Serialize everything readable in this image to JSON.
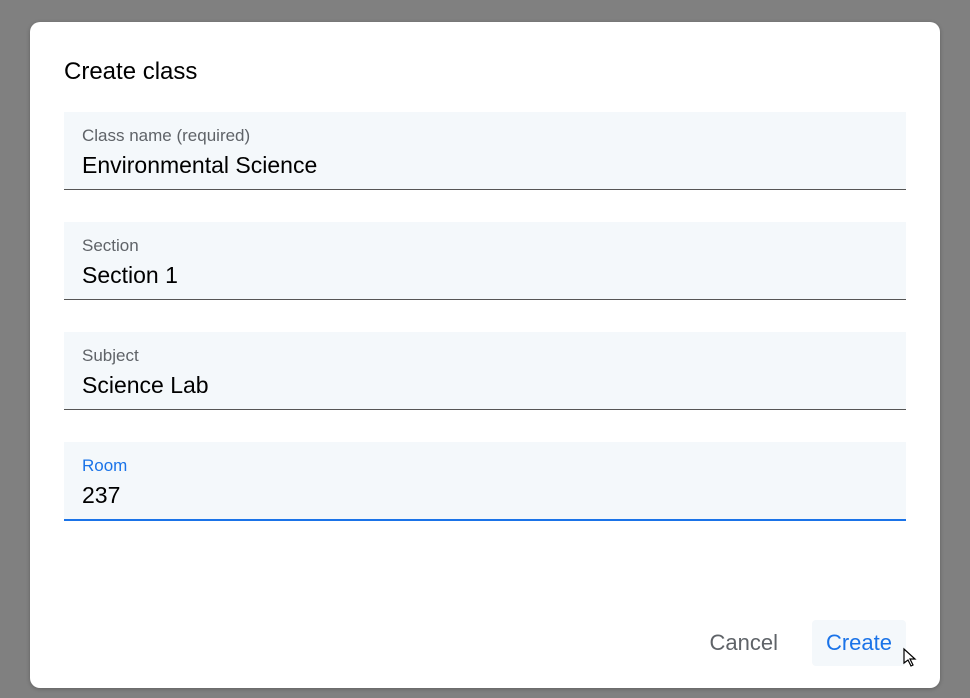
{
  "dialog": {
    "title": "Create class",
    "fields": {
      "class_name": {
        "label": "Class name (required)",
        "value": "Environmental Science"
      },
      "section": {
        "label": "Section",
        "value": "Section 1"
      },
      "subject": {
        "label": "Subject",
        "value": "Science Lab"
      },
      "room": {
        "label": "Room",
        "value": "237"
      }
    },
    "actions": {
      "cancel": "Cancel",
      "create": "Create"
    }
  }
}
